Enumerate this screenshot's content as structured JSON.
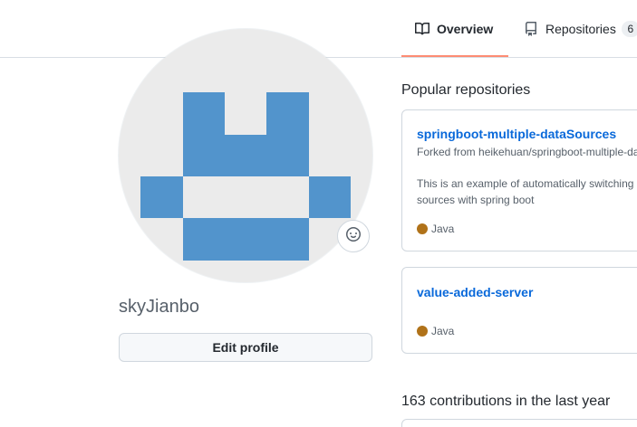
{
  "tabs": [
    {
      "label": "Overview",
      "icon": "book-icon",
      "selected": true
    },
    {
      "label": "Repositories",
      "icon": "repo-icon",
      "count": "6"
    }
  ],
  "colors": {
    "tab_underline": "#fd8c73",
    "avatar_blocks": "#5294cc",
    "link": "#0969da",
    "java": "#b07219"
  },
  "profile": {
    "username": "skyJianbo",
    "edit_button": "Edit profile",
    "status_icon": "smiley-icon"
  },
  "popular": {
    "title": "Popular repositories",
    "repos": [
      {
        "name": "springboot-multiple-dataSources",
        "forked_from": "Forked from heikehuan/springboot-multiple-dataSources",
        "description": "This is an example of automatically switching data sources with spring boot",
        "language": "Java"
      },
      {
        "name": "value-added-server",
        "language": "Java"
      }
    ]
  },
  "contributions": {
    "title": "163 contributions in the last year"
  }
}
